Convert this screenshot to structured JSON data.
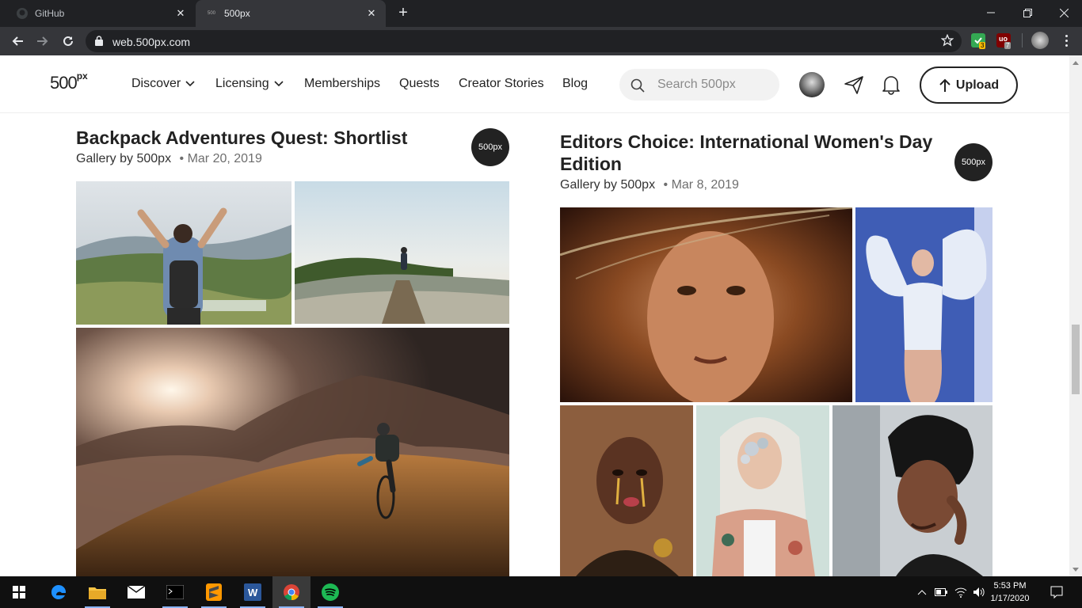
{
  "browser": {
    "tabs": [
      {
        "title": "GitHub",
        "active": false
      },
      {
        "title": "500px",
        "active": true
      }
    ],
    "url": "web.500px.com",
    "extensions": [
      {
        "name": "shield-extension",
        "badge": "3",
        "color": "#34a853"
      },
      {
        "name": "ublock-extension",
        "badge": "7",
        "color": "#800000"
      }
    ]
  },
  "site": {
    "logo": "500",
    "logo_sup": "px",
    "nav": [
      {
        "label": "Discover",
        "dropdown": true
      },
      {
        "label": "Licensing",
        "dropdown": true
      },
      {
        "label": "Memberships",
        "dropdown": false
      },
      {
        "label": "Quests",
        "dropdown": false
      },
      {
        "label": "Creator Stories",
        "dropdown": false
      },
      {
        "label": "Blog",
        "dropdown": false
      }
    ],
    "search_placeholder": "Search 500px",
    "upload_label": "Upload"
  },
  "galleries": [
    {
      "title": "Backpack Adventures Quest: Shortlist",
      "byline": "Gallery by 500px",
      "date": "• Mar 20, 2019",
      "badge": "500px",
      "photos": [
        "hiker-arms-raised-photo",
        "hiker-on-ridge-photo",
        "cyclist-mountain-sunrise-photo"
      ]
    },
    {
      "title": "Editors Choice: International Women's Day",
      "title_line2": "Edition",
      "byline": "Gallery by 500px",
      "date": "• Mar 8, 2019",
      "badge": "500px",
      "photos": [
        "curly-hair-portrait-photo",
        "woman-with-wings-photo",
        "gold-tears-portrait-photo",
        "floral-face-portrait-photo",
        "headwrap-portrait-photo"
      ]
    }
  ],
  "taskbar": {
    "apps": [
      "start-button",
      "edge-icon",
      "file-explorer-icon",
      "mail-icon",
      "terminal-icon",
      "sublime-icon",
      "word-icon",
      "chrome-icon",
      "spotify-icon"
    ],
    "time": "5:53 PM",
    "date": "1/17/2020"
  }
}
